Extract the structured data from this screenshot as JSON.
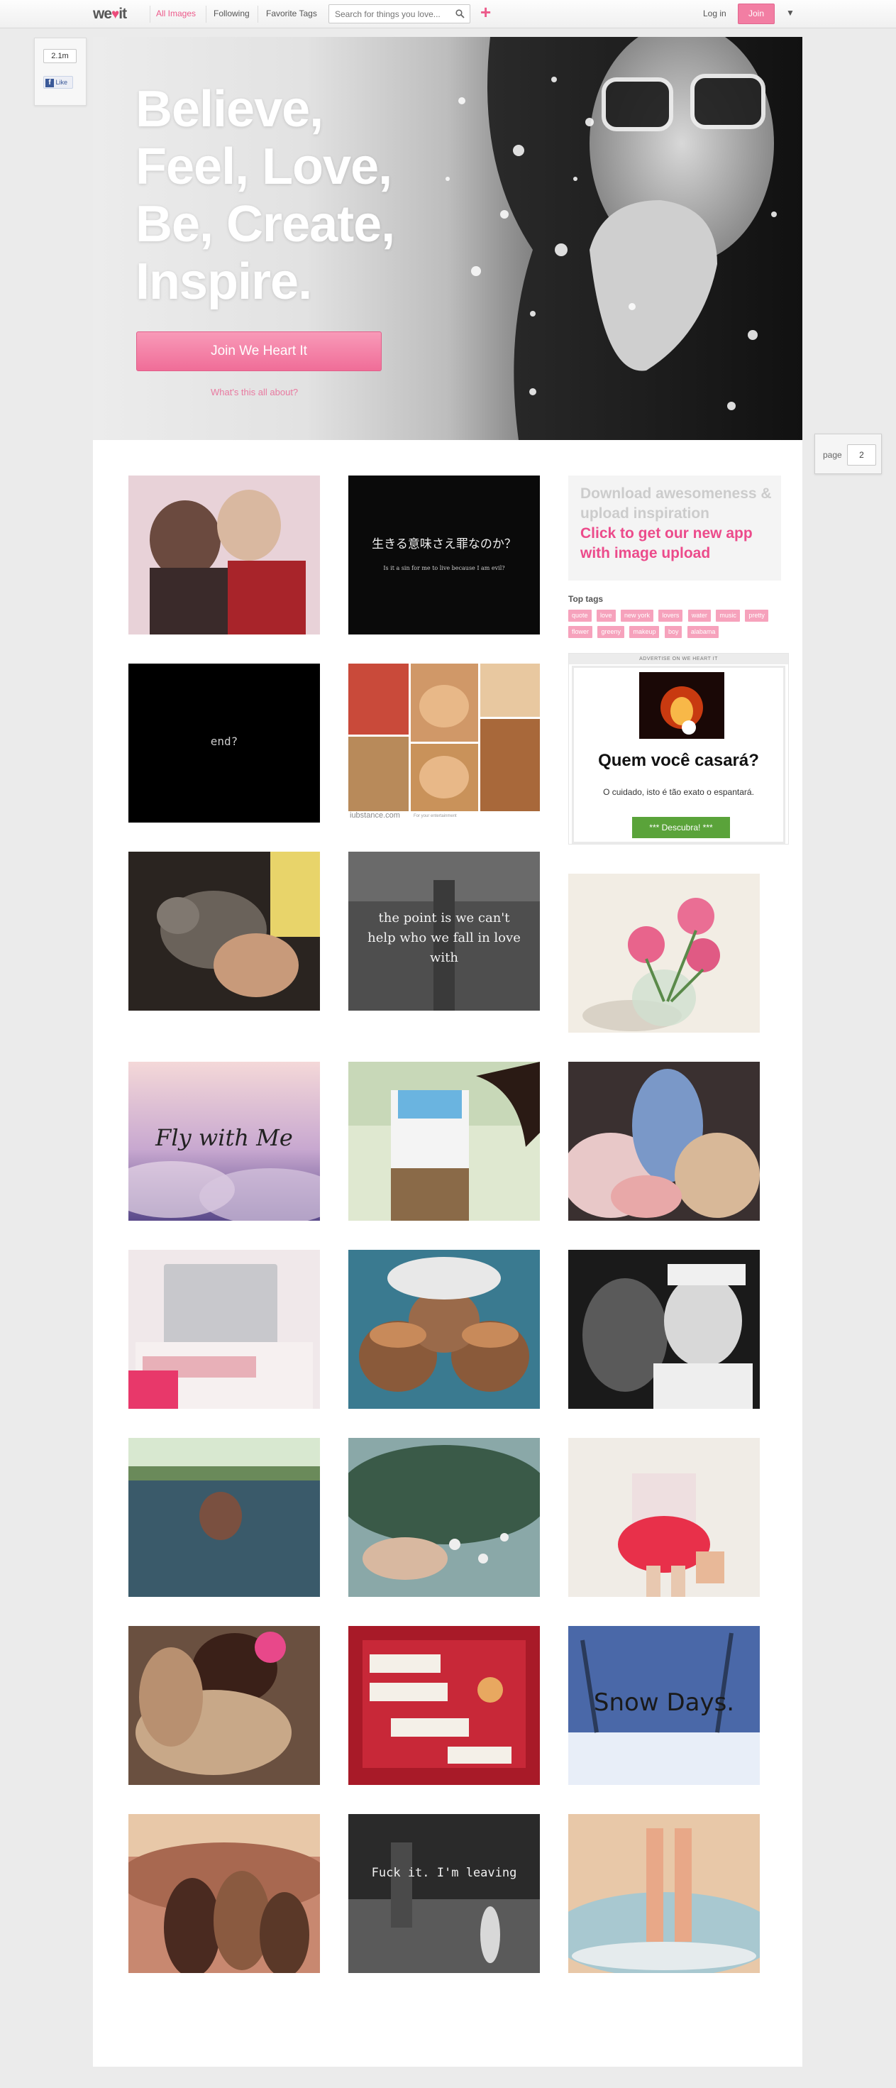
{
  "topbar": {
    "logo_we": "we",
    "logo_it": "it",
    "nav": [
      "All Images",
      "Following",
      "Favorite Tags"
    ],
    "search_placeholder": "Search for things you love...",
    "plus": "+",
    "login": "Log in",
    "join": "Join",
    "menu_arrow": "▼"
  },
  "likebox": {
    "count": "2.1m",
    "like": "Like"
  },
  "hero": {
    "title_lines": [
      "Believe,",
      "Feel, Love,",
      "Be, Create,",
      "Inspire."
    ],
    "join_button": "Join We Heart It",
    "whats_this": "What's this all about?"
  },
  "pager": {
    "label": "page",
    "value": "2"
  },
  "tiles": [
    {
      "label": ""
    },
    {
      "label": "生きる意味さえ罪なのか？",
      "sublabel": "Is it a sin for me to live because I am evil?"
    },
    {
      "label": "end?"
    },
    {
      "label": "iubstance.com",
      "sublabel": "For your entertainment"
    },
    {
      "label": ""
    },
    {
      "label": "the point is we can't help who we fall in love with"
    },
    {
      "label": ""
    },
    {
      "label": "Fly with Me"
    },
    {
      "label": ""
    },
    {
      "label": ""
    },
    {
      "label": ""
    },
    {
      "label": ""
    },
    {
      "label": ""
    },
    {
      "label": ""
    },
    {
      "label": ""
    },
    {
      "label": ""
    },
    {
      "label": ""
    },
    {
      "label": ""
    },
    {
      "label": ""
    },
    {
      "label": "Snow Days."
    },
    {
      "label": ""
    },
    {
      "label": "Fuck it. I'm leaving"
    },
    {
      "label": ""
    }
  ],
  "promo": {
    "line1": "Download awesomeness & upload inspiration",
    "line2": "Click to get our new app with image upload"
  },
  "top_tags": {
    "heading": "Top tags",
    "items": [
      "quote",
      "love",
      "new york",
      "lovers",
      "water",
      "music",
      "pretty",
      "flower",
      "greeny",
      "makeup",
      "boy",
      "alabama"
    ]
  },
  "ad": {
    "label": "ADVERTISE ON WE HEART IT",
    "title": "Quem você casará?",
    "subtitle": "O cuidado, isto é tão exato o espantará.",
    "button": "*** Descubra! ***"
  },
  "colors": {
    "accent": "#ec5a8a",
    "join": "#f27ea3",
    "tag": "#f6a2bc",
    "ad_button": "#5aa33a"
  }
}
